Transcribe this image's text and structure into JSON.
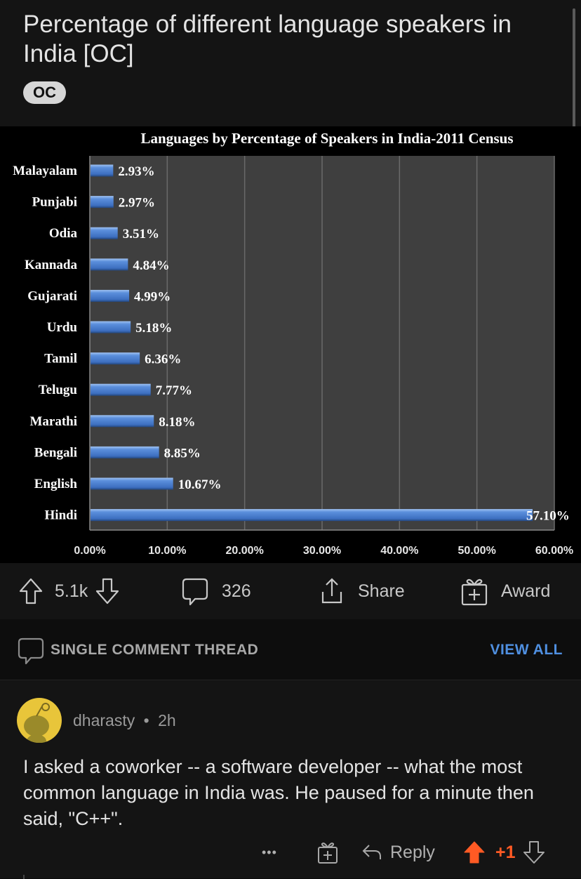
{
  "post": {
    "title": "Percentage of different language speakers in India [OC]",
    "flair": "OC"
  },
  "chart_data": {
    "type": "bar",
    "orientation": "horizontal",
    "title": "Languages by Percentage of Speakers in India-2011 Census",
    "categories": [
      "Malayalam",
      "Punjabi",
      "Odia",
      "Kannada",
      "Gujarati",
      "Urdu",
      "Tamil",
      "Telugu",
      "Marathi",
      "Bengali",
      "English",
      "Hindi"
    ],
    "values": [
      2.93,
      2.97,
      3.51,
      4.84,
      4.99,
      5.18,
      6.36,
      7.77,
      8.18,
      8.85,
      10.67,
      57.1
    ],
    "data_labels": [
      "2.93%",
      "2.97%",
      "3.51%",
      "4.84%",
      "4.99%",
      "5.18%",
      "6.36%",
      "7.77%",
      "8.18%",
      "8.85%",
      "10.67%",
      "57.10%"
    ],
    "xlabel": "",
    "ylabel": "",
    "xlim": [
      0,
      60
    ],
    "x_ticks": [
      0,
      10,
      20,
      30,
      40,
      50,
      60
    ],
    "x_tick_labels": [
      "0.00%",
      "10.00%",
      "20.00%",
      "30.00%",
      "40.00%",
      "50.00%",
      "60.00%"
    ],
    "grid": true,
    "legend": "none",
    "colors": {
      "bar": "#4a7fd0",
      "plot_bg": "#3f3f3f",
      "grid": "#6a6a6a",
      "text": "#ffffff"
    }
  },
  "actions": {
    "upvote_count": "5.1k",
    "comment_count": "326",
    "share_label": "Share",
    "award_label": "Award"
  },
  "thread": {
    "label": "SINGLE COMMENT THREAD",
    "view_all": "VIEW ALL",
    "accent": "#4f8fe0"
  },
  "comment": {
    "author": "dharasty",
    "separator": "•",
    "age": "2h",
    "body": "I asked a coworker -- a software developer -- what the most common language in India was. He paused for a minute then said, \"C++\".",
    "more": "•••",
    "reply_label": "Reply",
    "score": "+1",
    "upvote_color": "#ff5a24"
  }
}
